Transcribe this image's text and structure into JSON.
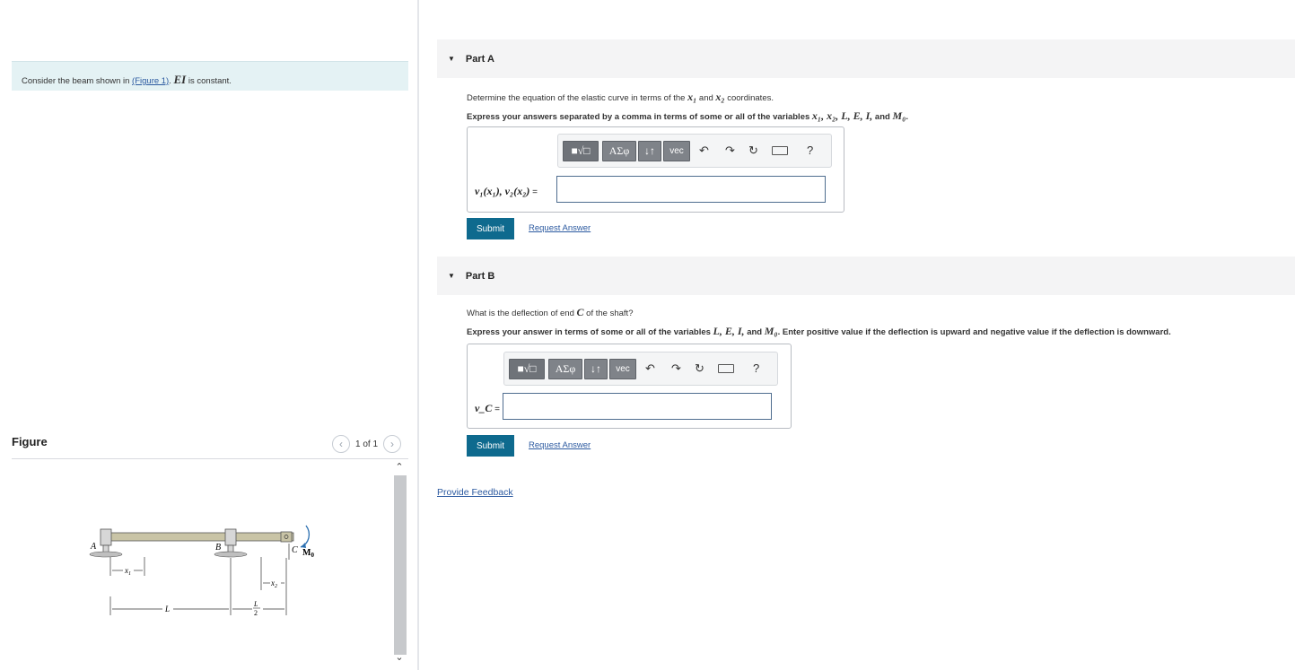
{
  "problem": {
    "prefix": "Consider the beam shown in ",
    "figure_link": "(Figure 1)",
    "mid": ". ",
    "ei": "EI",
    "suffix": " is constant."
  },
  "figure": {
    "title": "Figure",
    "pager": "1 of 1",
    "prev_icon": "chevron-left-icon",
    "next_icon": "chevron-right-icon",
    "labels": {
      "A": "A",
      "B": "B",
      "C": "C",
      "M": "M",
      "M_sub": "0",
      "x1": "x",
      "x1_sub": "1",
      "x2": "x",
      "x2_sub": "2",
      "L": "L",
      "half_num": "L",
      "half_den": "2"
    }
  },
  "partA": {
    "label": "Part A",
    "question_pre": "Determine the equation of the elastic curve in terms of the ",
    "q_x1": "x₁",
    "q_and": " and ",
    "q_x2": "x₂",
    "question_post": " coordinates.",
    "instr_pre": "Express your answers separated by a comma in terms of some or all of the variables ",
    "instr_vars": "x₁, x₂, L, E, I,",
    "instr_and": " and ",
    "instr_m": "M₀",
    "instr_end": ".",
    "var_label": "v₁(x₁), v₂(x₂)",
    "eq": " =",
    "input_value": "",
    "submit": "Submit",
    "request": "Request Answer"
  },
  "partB": {
    "label": "Part B",
    "question_pre": "What is the deflection of end ",
    "q_c": "C",
    "question_post": " of the shaft?",
    "instr_pre": "Express your answer in terms of some or all of the variables ",
    "instr_vars": "L, E, I,",
    "instr_and": " and ",
    "instr_m": "M₀",
    "instr_post": ". Enter positive value if the deflection is upward and negative value if the deflection is downward.",
    "var_label": "v_C",
    "eq": " =",
    "input_value": "",
    "submit": "Submit",
    "request": "Request Answer"
  },
  "toolbar": {
    "sqrt": "■√□",
    "greek": "ΑΣφ",
    "arrows": "↓↑",
    "vec": "vec",
    "undo_icon": "undo-icon",
    "redo_icon": "redo-icon",
    "reset_icon": "reset-icon",
    "keyboard_icon": "keyboard-icon",
    "help": "?"
  },
  "feedback": "Provide Feedback",
  "colors": {
    "accent": "#0e6a8e",
    "link": "#2c5aa0",
    "problem_bg": "#e4f2f4"
  }
}
